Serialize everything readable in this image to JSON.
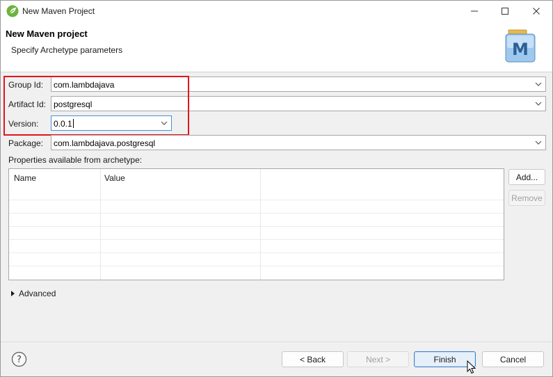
{
  "window": {
    "title": "New Maven Project",
    "controls": {
      "minimize": "minimize-icon",
      "maximize": "maximize-icon",
      "close": "close-icon"
    }
  },
  "banner": {
    "title": "New Maven project",
    "subtitle": "Specify Archetype parameters",
    "logo_letter": "M"
  },
  "form": {
    "group_id": {
      "label": "Group Id:",
      "value": "com.lambdajava"
    },
    "artifact_id": {
      "label": "Artifact Id:",
      "value": "postgresql"
    },
    "version": {
      "label": "Version:",
      "value": "0.0.1"
    },
    "package": {
      "label": "Package:",
      "value": "com.lambdajava.postgresql"
    }
  },
  "properties": {
    "label": "Properties available from archetype:",
    "columns": [
      "Name",
      "Value"
    ],
    "rows": [],
    "add_label": "Add...",
    "remove_label": "Remove"
  },
  "advanced": {
    "label": "Advanced",
    "expanded": false
  },
  "footer": {
    "help_icon": "help-icon",
    "back_label": "< Back",
    "next_label": "Next >",
    "finish_label": "Finish",
    "cancel_label": "Cancel"
  },
  "colors": {
    "highlight": "#e3141c",
    "focus": "#4a8fd6",
    "primary_button_border": "#3d7fc7"
  }
}
